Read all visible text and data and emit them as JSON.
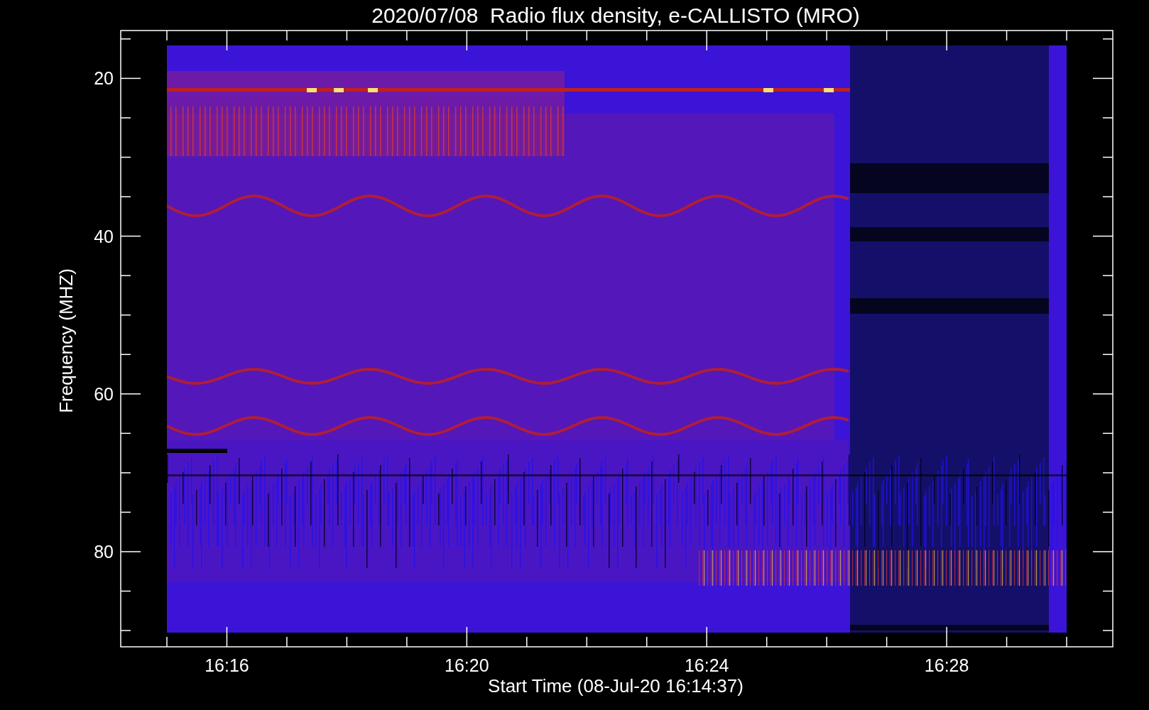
{
  "title": "2020/07/08  Radio flux density, e-CALLISTO (MRO)",
  "y_axis": {
    "label": "Frequency (MHZ)",
    "ticks": [
      "20",
      "40",
      "60",
      "80"
    ]
  },
  "x_axis": {
    "label": "Start Time (08-Jul-20 16:14:37)",
    "ticks": [
      "16:16",
      "16:20",
      "16:24",
      "16:28"
    ]
  }
}
